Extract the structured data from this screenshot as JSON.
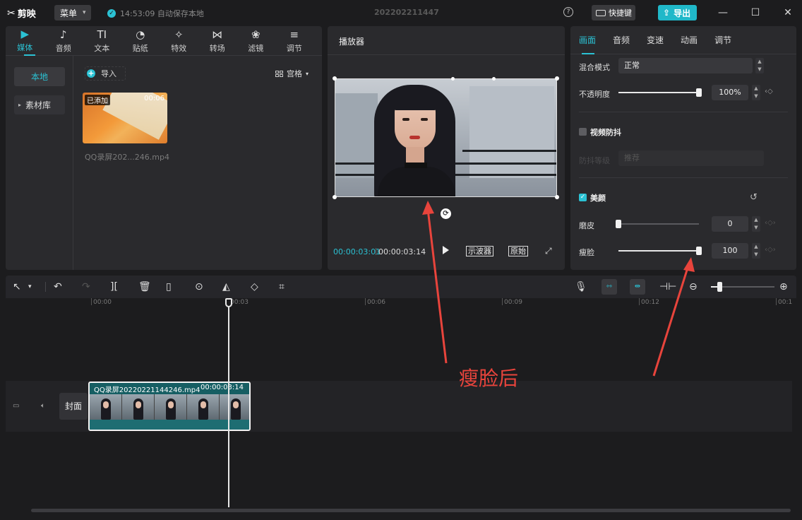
{
  "topbar": {
    "logo": "剪映",
    "menu_label": "菜单",
    "save_status": "14:53:09 自动保存本地",
    "doc_title": "202202211447",
    "help": "?",
    "shortcut_label": "快捷键",
    "export_label": "导出"
  },
  "media": {
    "tabs": [
      {
        "label": "媒体",
        "icon": "▶"
      },
      {
        "label": "音频",
        "icon": "♪"
      },
      {
        "label": "文本",
        "icon": "TI"
      },
      {
        "label": "贴纸",
        "icon": "◔"
      },
      {
        "label": "特效",
        "icon": "✧"
      },
      {
        "label": "转场",
        "icon": "⋈"
      },
      {
        "label": "滤镜",
        "icon": "❀"
      },
      {
        "label": "调节",
        "icon": "≡"
      }
    ],
    "sidebar": [
      {
        "label": "本地"
      },
      {
        "label": "素材库"
      }
    ],
    "import_label": "导入",
    "view_label": "宫格",
    "thumb": {
      "badge": "已添加",
      "duration": "00:06",
      "name": "QQ录屏202...246.mp4"
    }
  },
  "player": {
    "title": "播放器",
    "time_current": "00:00:03:01",
    "time_total": "00:00:03:14",
    "scope_label": "示波器",
    "original_label": "原始"
  },
  "props": {
    "tabs": [
      "画面",
      "音频",
      "变速",
      "动画",
      "调节"
    ],
    "blend_label": "混合模式",
    "blend_value": "正常",
    "opacity_label": "不透明度",
    "opacity_value": "100%",
    "opacity_level": 1.0,
    "stabilize_label": "视频防抖",
    "stabilize_sub_label": "防抖等级",
    "stabilize_sub_value": "推荐",
    "beauty_label": "美颜",
    "smooth_label": "磨皮",
    "smooth_value": "0",
    "smooth_level": 0.0,
    "slim_label": "瘦脸",
    "slim_value": "100",
    "slim_level": 1.0
  },
  "timeline": {
    "ruler": [
      "00:00",
      "00:03",
      "00:06",
      "00:09",
      "00:12",
      "00:1"
    ],
    "cover_label": "封面",
    "clip_name": "QQ录屏20220221144246.mp4",
    "clip_duration": "00:00:03:14"
  },
  "annotation": {
    "text": "瘦脸后"
  },
  "colors": {
    "accent": "#2bc2d4",
    "annotation": "#e8443c",
    "bg": "#1c1c1e",
    "panel": "#2a2a2d"
  }
}
